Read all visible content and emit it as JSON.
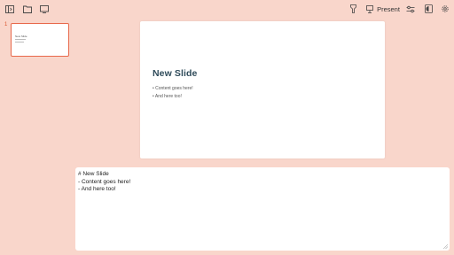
{
  "toolbar": {
    "left_icons": [
      "sidebar-toggle-icon",
      "folder-icon",
      "monitor-icon"
    ],
    "present_label": "Present",
    "right_icons": [
      "flashlight-icon",
      "presentation-icon",
      "sliders-icon",
      "theme-icon",
      "gear-icon"
    ]
  },
  "thumbnails": [
    {
      "number": "1",
      "title": "New Slide"
    }
  ],
  "slide": {
    "title": "New Slide",
    "bullets": [
      "• Content goes here!",
      "• And here too!"
    ]
  },
  "editor": {
    "lines": [
      "# New Slide",
      "- Content goes here!",
      "- And here too!"
    ]
  },
  "colors": {
    "background": "#f9d6cb",
    "accent": "#e8684a",
    "title": "#2f4b5a"
  }
}
